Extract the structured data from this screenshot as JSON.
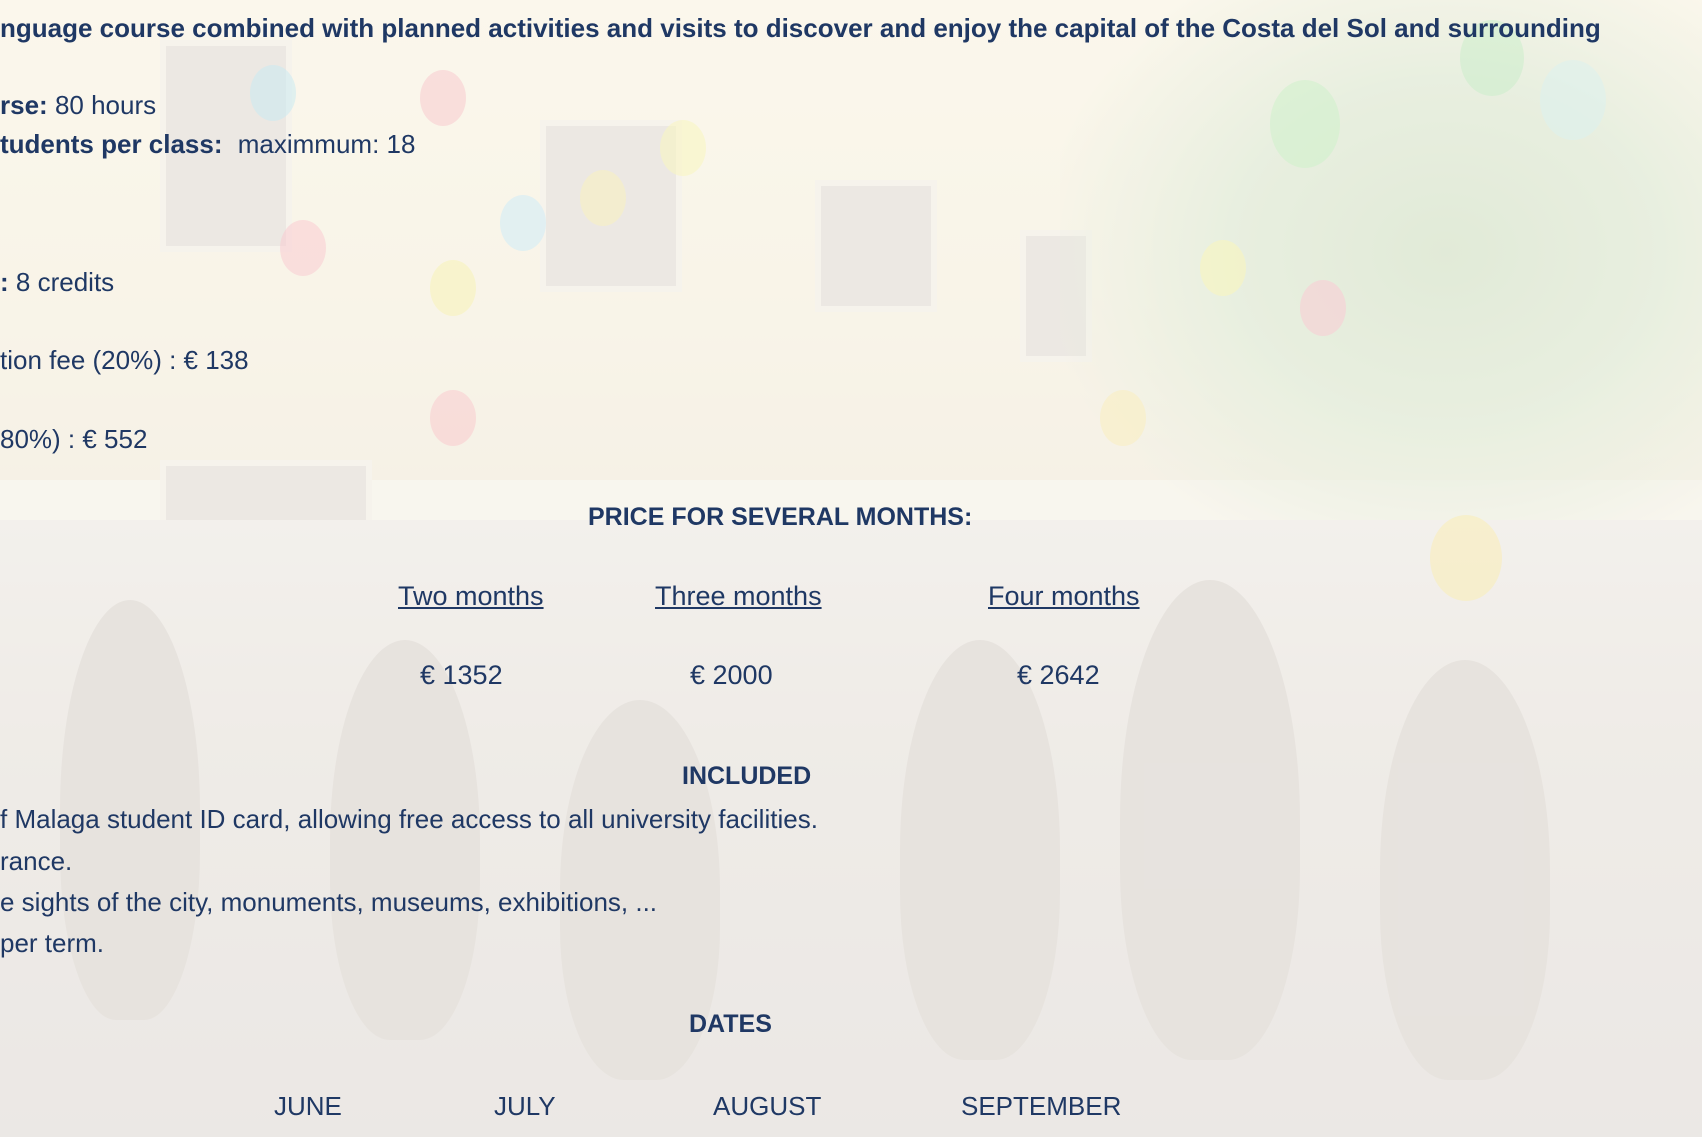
{
  "intro": {
    "text": "nguage course combined with planned activities and visits to discover and enjoy the capital of the Costa del Sol and surrounding"
  },
  "details": {
    "course_label": "rse:",
    "course_value": "80 hours",
    "students_label": "tudents per class:",
    "students_value": "maximmum: 18",
    "credits_label": ":",
    "credits_value": "8 credits",
    "reservation_text": "tion fee (20%) : € 138",
    "remainder_text": "80%) : € 552"
  },
  "pricing": {
    "heading": "PRICE FOR SEVERAL MONTHS:",
    "columns": [
      {
        "label": "Two months",
        "price": "€ 1352"
      },
      {
        "label": "Three months",
        "price": "€ 2000"
      },
      {
        "label": "Four months",
        "price": "€ 2642"
      }
    ]
  },
  "included": {
    "heading": "INCLUDED",
    "items": [
      "f Malaga student ID card, allowing free access to all university facilities.",
      "rance.",
      "e sights of the city, monuments, museums, exhibitions, ...",
      "per term."
    ]
  },
  "dates": {
    "heading": "DATES",
    "months": [
      "JUNE",
      "JULY",
      "AUGUST",
      "SEPTEMBER"
    ]
  },
  "colors": {
    "text": "#1f3864"
  }
}
